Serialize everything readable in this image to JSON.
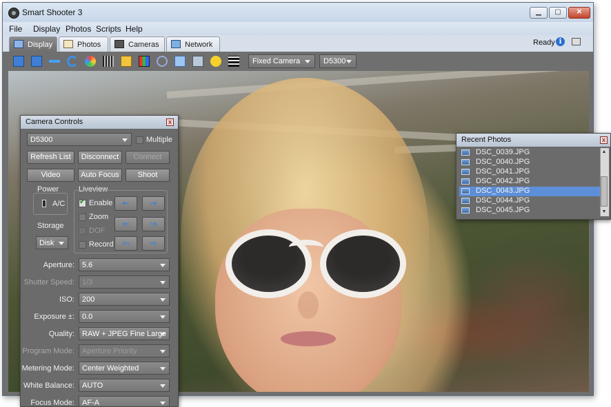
{
  "window": {
    "title": "Smart Shooter 3",
    "controls": {
      "minimize": "▁",
      "maximize": "▢",
      "close": "✕"
    }
  },
  "menu": [
    "File",
    "Display",
    "Photos",
    "Scripts",
    "Help"
  ],
  "tabs": [
    {
      "label": "Display",
      "icon": "monitor-icon",
      "active": true
    },
    {
      "label": "Photos",
      "icon": "photos-icon",
      "active": false
    },
    {
      "label": "Cameras",
      "icon": "camera-icon",
      "active": false
    },
    {
      "label": "Network",
      "icon": "network-icon",
      "active": false
    }
  ],
  "status": {
    "text": "Ready"
  },
  "toolbar": {
    "camera_mode": "Fixed Camera",
    "camera_model": "D5300"
  },
  "camera_controls": {
    "title": "Camera Controls",
    "camera_select": "D5300",
    "multiple_label": "Multiple",
    "buttons": {
      "refresh": "Refresh List",
      "disconnect": "Disconnect",
      "connect": "Connect",
      "video": "Video",
      "auto_focus": "Auto Focus",
      "shoot": "Shoot"
    },
    "power": {
      "label": "Power",
      "value": "A/C"
    },
    "storage": {
      "label": "Storage",
      "value": "Disk"
    },
    "liveview": {
      "label": "Liveview",
      "enable": "Enable",
      "zoom": "Zoom",
      "dof": "DOF",
      "record": "Record"
    },
    "settings": [
      {
        "label": "Aperture:",
        "value": "5.6",
        "disabled": false
      },
      {
        "label": "Shutter Speed:",
        "value": "1/3",
        "disabled": true
      },
      {
        "label": "ISO:",
        "value": "200",
        "disabled": false
      },
      {
        "label": "Exposure ±:",
        "value": "0.0",
        "disabled": false
      },
      {
        "label": "Quality:",
        "value": "RAW + JPEG Fine Large",
        "disabled": false
      },
      {
        "label": "Program Mode:",
        "value": "Aperture Priority",
        "disabled": true
      },
      {
        "label": "Metering Mode:",
        "value": "Center Weighted",
        "disabled": false
      },
      {
        "label": "White Balance:",
        "value": "AUTO",
        "disabled": false
      },
      {
        "label": "Focus Mode:",
        "value": "AF-A",
        "disabled": false
      }
    ]
  },
  "recent_photos": {
    "title": "Recent Photos",
    "items": [
      {
        "name": "DSC_0039.JPG",
        "selected": false
      },
      {
        "name": "DSC_0040.JPG",
        "selected": false
      },
      {
        "name": "DSC_0041.JPG",
        "selected": false
      },
      {
        "name": "DSC_0042.JPG",
        "selected": false
      },
      {
        "name": "DSC_0043.JPG",
        "selected": true
      },
      {
        "name": "DSC_0044.JPG",
        "selected": false
      },
      {
        "name": "DSC_0045.JPG",
        "selected": false
      }
    ]
  },
  "colors": {
    "accent": "#5d8fd8",
    "panel": "#6b6b6b"
  }
}
